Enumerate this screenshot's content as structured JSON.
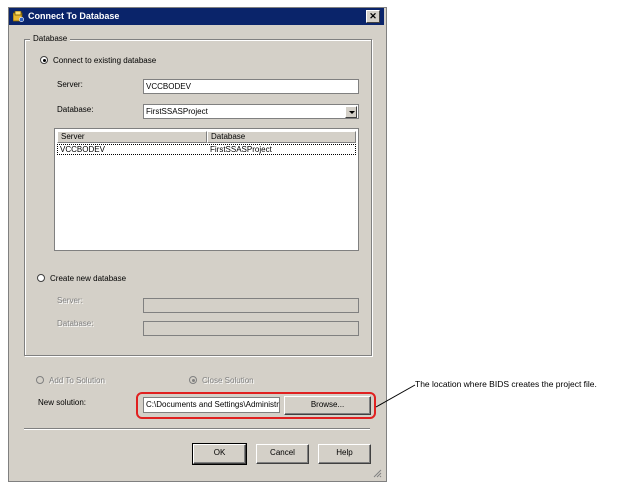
{
  "dialog": {
    "title": "Connect To Database",
    "close_glyph": "✕"
  },
  "database_group": {
    "title": "Database",
    "connect_existing": {
      "label": "Connect to existing database",
      "checked": true
    },
    "server_label": "Server:",
    "server_value": "VCCBODEV",
    "database_label": "Database:",
    "database_value": "FirstSSASProject",
    "list": {
      "columns": [
        "Server",
        "Database"
      ],
      "rows": [
        {
          "server": "VCCBODEV",
          "database": "FirstSSASProject"
        }
      ]
    },
    "create_new": {
      "label": "Create new database",
      "checked": false
    },
    "new_server_label": "Server:",
    "new_database_label": "Database:"
  },
  "solution": {
    "add_to_solution_label": "Add To Solution",
    "close_solution_label": "Close Solution",
    "new_solution_label": "New solution:",
    "path_value": "C:\\Documents and Settings\\Administr",
    "browse_label": "Browse..."
  },
  "buttons": {
    "ok": "OK",
    "cancel": "Cancel",
    "help": "Help"
  },
  "callout": {
    "text": "The location where BIDS creates the project file."
  },
  "icons": {
    "app": "database-folder-icon",
    "close": "close-icon",
    "dropdown": "chevron-down-icon",
    "grip": "resize-grip-icon"
  },
  "colors": {
    "titlebar": "#0a246a",
    "dialog_face": "#d4d0c8",
    "highlight": "#e02020"
  }
}
